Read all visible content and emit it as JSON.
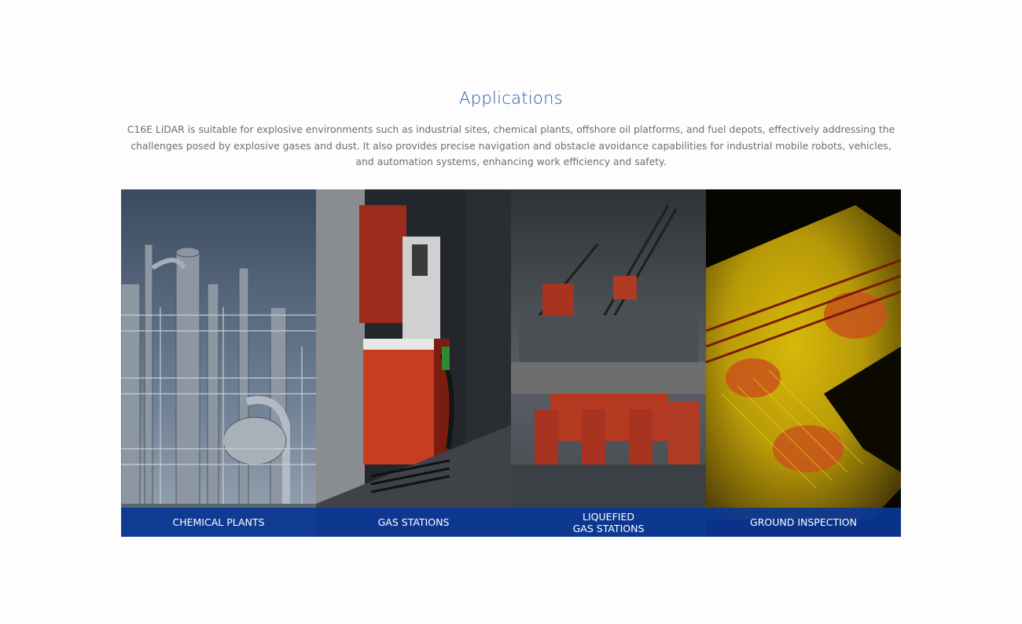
{
  "section": {
    "title": "Applications",
    "description": "C16E LiDAR is suitable for explosive environments such as industrial sites, chemical plants, offshore oil platforms, and fuel depots, effectively addressing the challenges posed by explosive gases and dust. It also provides precise navigation and obstacle avoidance capabilities for industrial mobile robots, vehicles, and automation systems, enhancing work efficiency and safety."
  },
  "applications": [
    {
      "label": "CHEMICAL PLANTS",
      "image": "chemical-plant-photo"
    },
    {
      "label": "GAS STATIONS",
      "image": "gas-pump-photo"
    },
    {
      "label": "LIQUEFIED\nGAS STATIONS",
      "image": "offshore-platform-photo"
    },
    {
      "label": "GROUND INSPECTION",
      "image": "lidar-point-cloud-image"
    }
  ],
  "colors": {
    "title": "#1f5aa8",
    "label_band": "#0a3796",
    "label_text": "#ffffff",
    "description": "#6e6e6e"
  }
}
